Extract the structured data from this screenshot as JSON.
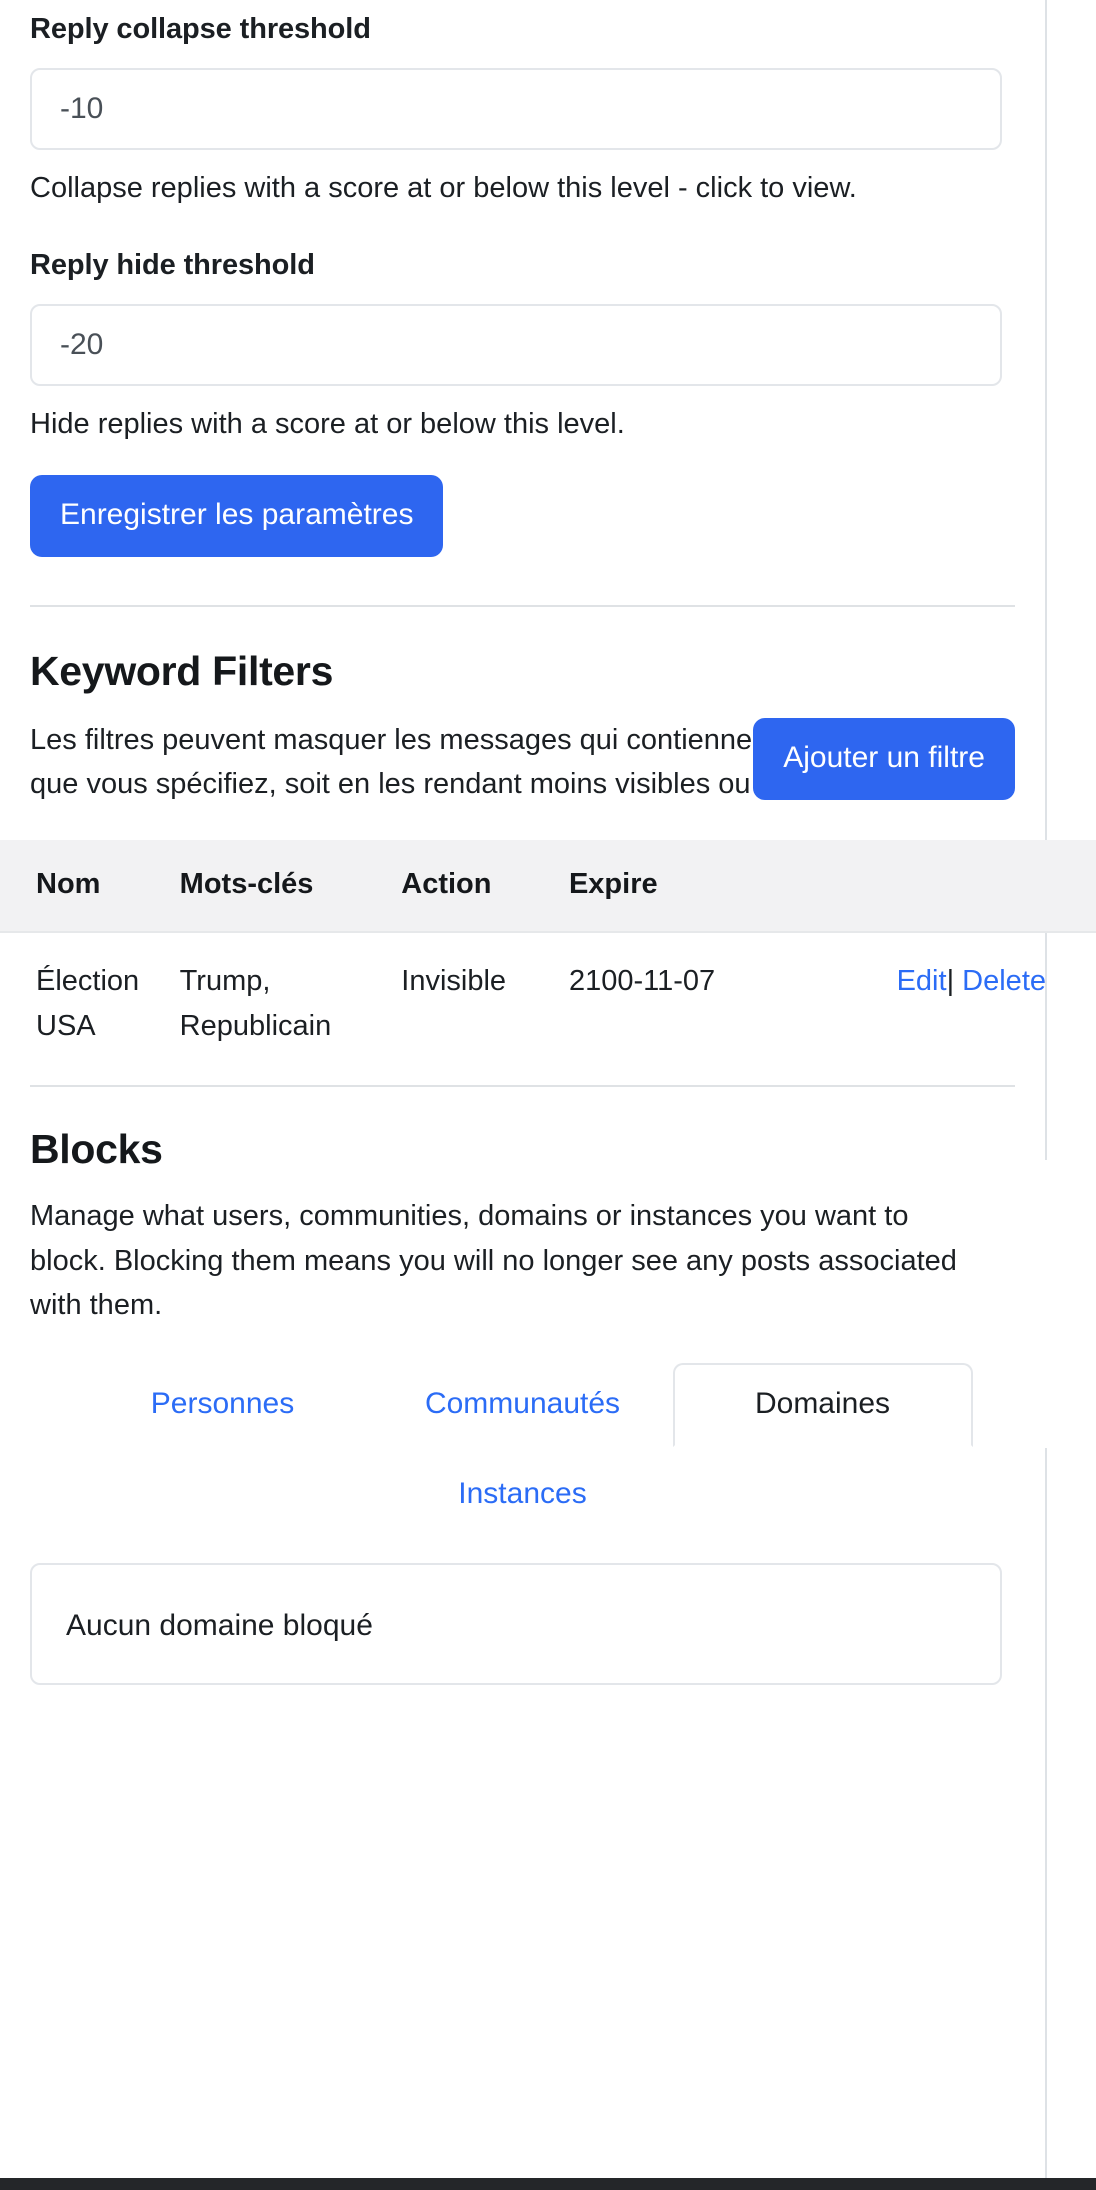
{
  "settings": {
    "collapse": {
      "label": "Reply collapse threshold",
      "value": "-10",
      "placeholder": "-10",
      "help": "Collapse replies with a score at or below this level - click to view."
    },
    "hide": {
      "label": "Reply hide threshold",
      "value": "-20",
      "placeholder": "-20",
      "help": "Hide replies with a score at or below this level."
    },
    "save_label": "Enregistrer les paramètres"
  },
  "keyword_filters": {
    "title": "Keyword Filters",
    "description": "Les filtres peuvent masquer les messages qui contiennent des mots-clés que vous spécifiez, soit en les rendant moins visibles ou invisibles.",
    "add_label": "Ajouter un filtre",
    "columns": {
      "nom": "Nom",
      "mots_cles": "Mots-clés",
      "action": "Action",
      "expire": "Expire",
      "ops": ""
    },
    "rows": [
      {
        "nom": "Élection USA",
        "mots_cles": "Trump, Republicain",
        "action": "Invisible",
        "expire": "2100-11-07",
        "edit_label": "Edit",
        "separator": "|",
        "delete_label": "Delete"
      }
    ]
  },
  "blocks": {
    "title": "Blocks",
    "description": "Manage what users, communities, domains or instances you want to block. Blocking them means you will no longer see any posts associated with them.",
    "tabs": [
      {
        "label": "Personnes",
        "active": false
      },
      {
        "label": "Communautés",
        "active": false
      },
      {
        "label": "Domaines",
        "active": true
      },
      {
        "label": "Instances",
        "active": false
      }
    ],
    "empty_message": "Aucun domaine bloqué"
  },
  "colors": {
    "accent": "#2e66f0",
    "link": "#2b6cf6",
    "border": "#e3e6ea",
    "table_header_bg": "#f2f2f3",
    "text": "#1b1f23"
  }
}
